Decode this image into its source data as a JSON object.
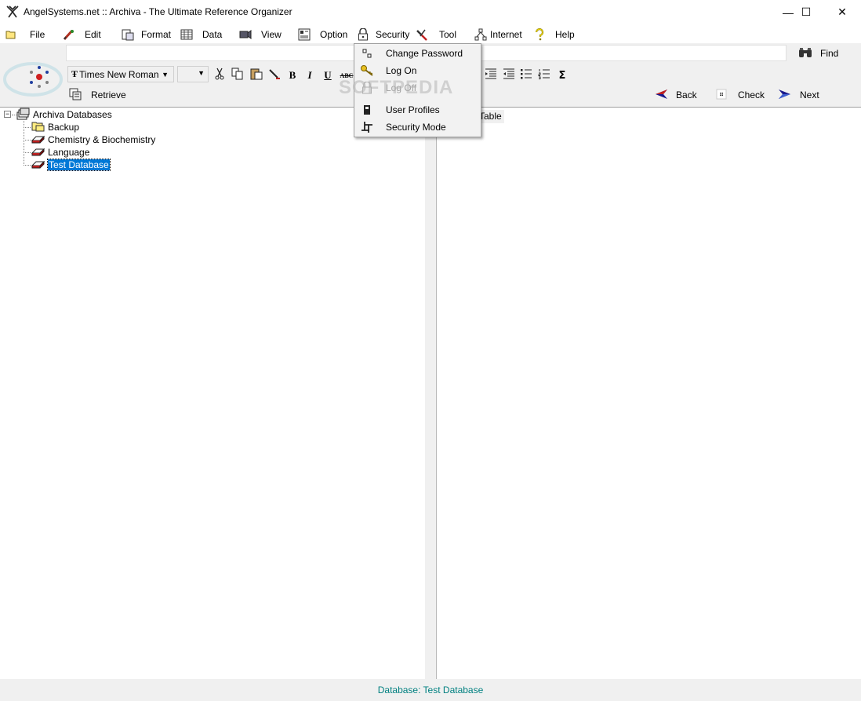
{
  "window": {
    "title": "AngelSystems.net :: Archiva - The Ultimate Reference Organizer",
    "minimize_glyph": "—",
    "maximize_glyph": "☐",
    "close_glyph": "✕"
  },
  "menubar": {
    "items": [
      {
        "label": "File",
        "icon": "folder-icon"
      },
      {
        "label": "Edit",
        "icon": "edit-icon"
      },
      {
        "label": "Format",
        "icon": "format-icon"
      },
      {
        "label": "Data",
        "icon": "data-grid-icon"
      },
      {
        "label": "View",
        "icon": "view-icon"
      },
      {
        "label": "Option",
        "icon": "option-icon"
      },
      {
        "label": "Security",
        "icon": "lock-icon"
      },
      {
        "label": "Tool",
        "icon": "tool-icon"
      },
      {
        "label": "Internet",
        "icon": "network-icon"
      },
      {
        "label": "Help",
        "icon": "help-icon"
      }
    ]
  },
  "toolbar": {
    "find_value": "",
    "find_label": "Find",
    "font_name": "Times New Roman",
    "font_size": "",
    "bold": "B",
    "italic": "I",
    "underline": "U",
    "strike": "ABC",
    "sum": "Σ",
    "retrieve_label": "Retrieve",
    "back_label": "Back",
    "check_label": "Check",
    "next_label": "Next"
  },
  "tree": {
    "root": "Archiva Databases",
    "children": [
      "Backup",
      "Chemistry & Biochemistry",
      "Language",
      "Test Database"
    ],
    "selected": "Test Database"
  },
  "right_pane": {
    "tab_label": "Table"
  },
  "security_menu": {
    "items": [
      {
        "label": "Change Password",
        "enabled": true
      },
      {
        "label": "Log On",
        "enabled": true
      },
      {
        "label": "Log Off",
        "enabled": false
      },
      {
        "label": "User Profiles",
        "enabled": true
      },
      {
        "label": "Security Mode",
        "enabled": true
      }
    ]
  },
  "watermark": "SOFTPEDIA",
  "status": {
    "text": "Database: Test Database"
  },
  "colors": {
    "selection": "#0078d7",
    "status_text": "#008080",
    "nav_arrow": "#1a1a8c"
  }
}
